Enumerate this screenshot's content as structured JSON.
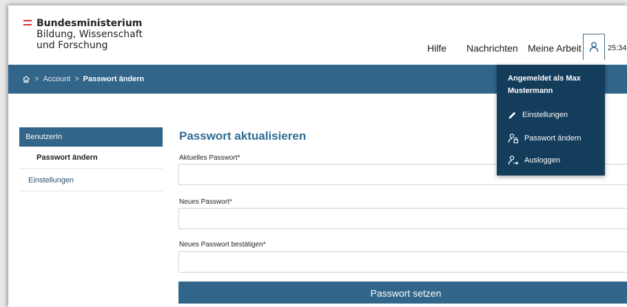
{
  "header": {
    "logo_lines": [
      "Bundesministerium",
      "Bildung, Wissenschaft",
      "und Forschung"
    ],
    "nav": [
      "Hilfe",
      "Nachrichten",
      "Meine Arbeit"
    ],
    "session_timer": "25:34"
  },
  "breadcrumb": {
    "items": [
      "Account",
      "Passwort ändern"
    ],
    "separator": ">"
  },
  "sidebar": {
    "heading": "BenutzerIn",
    "items": [
      "Passwort ändern",
      "Einstellungen"
    ]
  },
  "form": {
    "title": "Passwort aktualisieren",
    "fields": [
      {
        "label": "Aktuelles Passwort*",
        "value": ""
      },
      {
        "label": "Neues Passwort*",
        "value": ""
      },
      {
        "label": "Neues Passwort bestätigen*",
        "value": ""
      }
    ],
    "submit_label": "Passwort setzen"
  },
  "user_menu": {
    "title": "Angemeldet als Max Mustermann",
    "items": [
      {
        "label": "Einstellungen",
        "icon": "pencil-icon"
      },
      {
        "label": "Passwort ändern",
        "icon": "user-lock-icon"
      },
      {
        "label": "Ausloggen",
        "icon": "user-logout-icon"
      }
    ]
  },
  "colors": {
    "primary": "#316589",
    "dropdown_bg": "#143d5c",
    "flag_red": "#e4252b",
    "title_blue": "#2f6b93"
  }
}
